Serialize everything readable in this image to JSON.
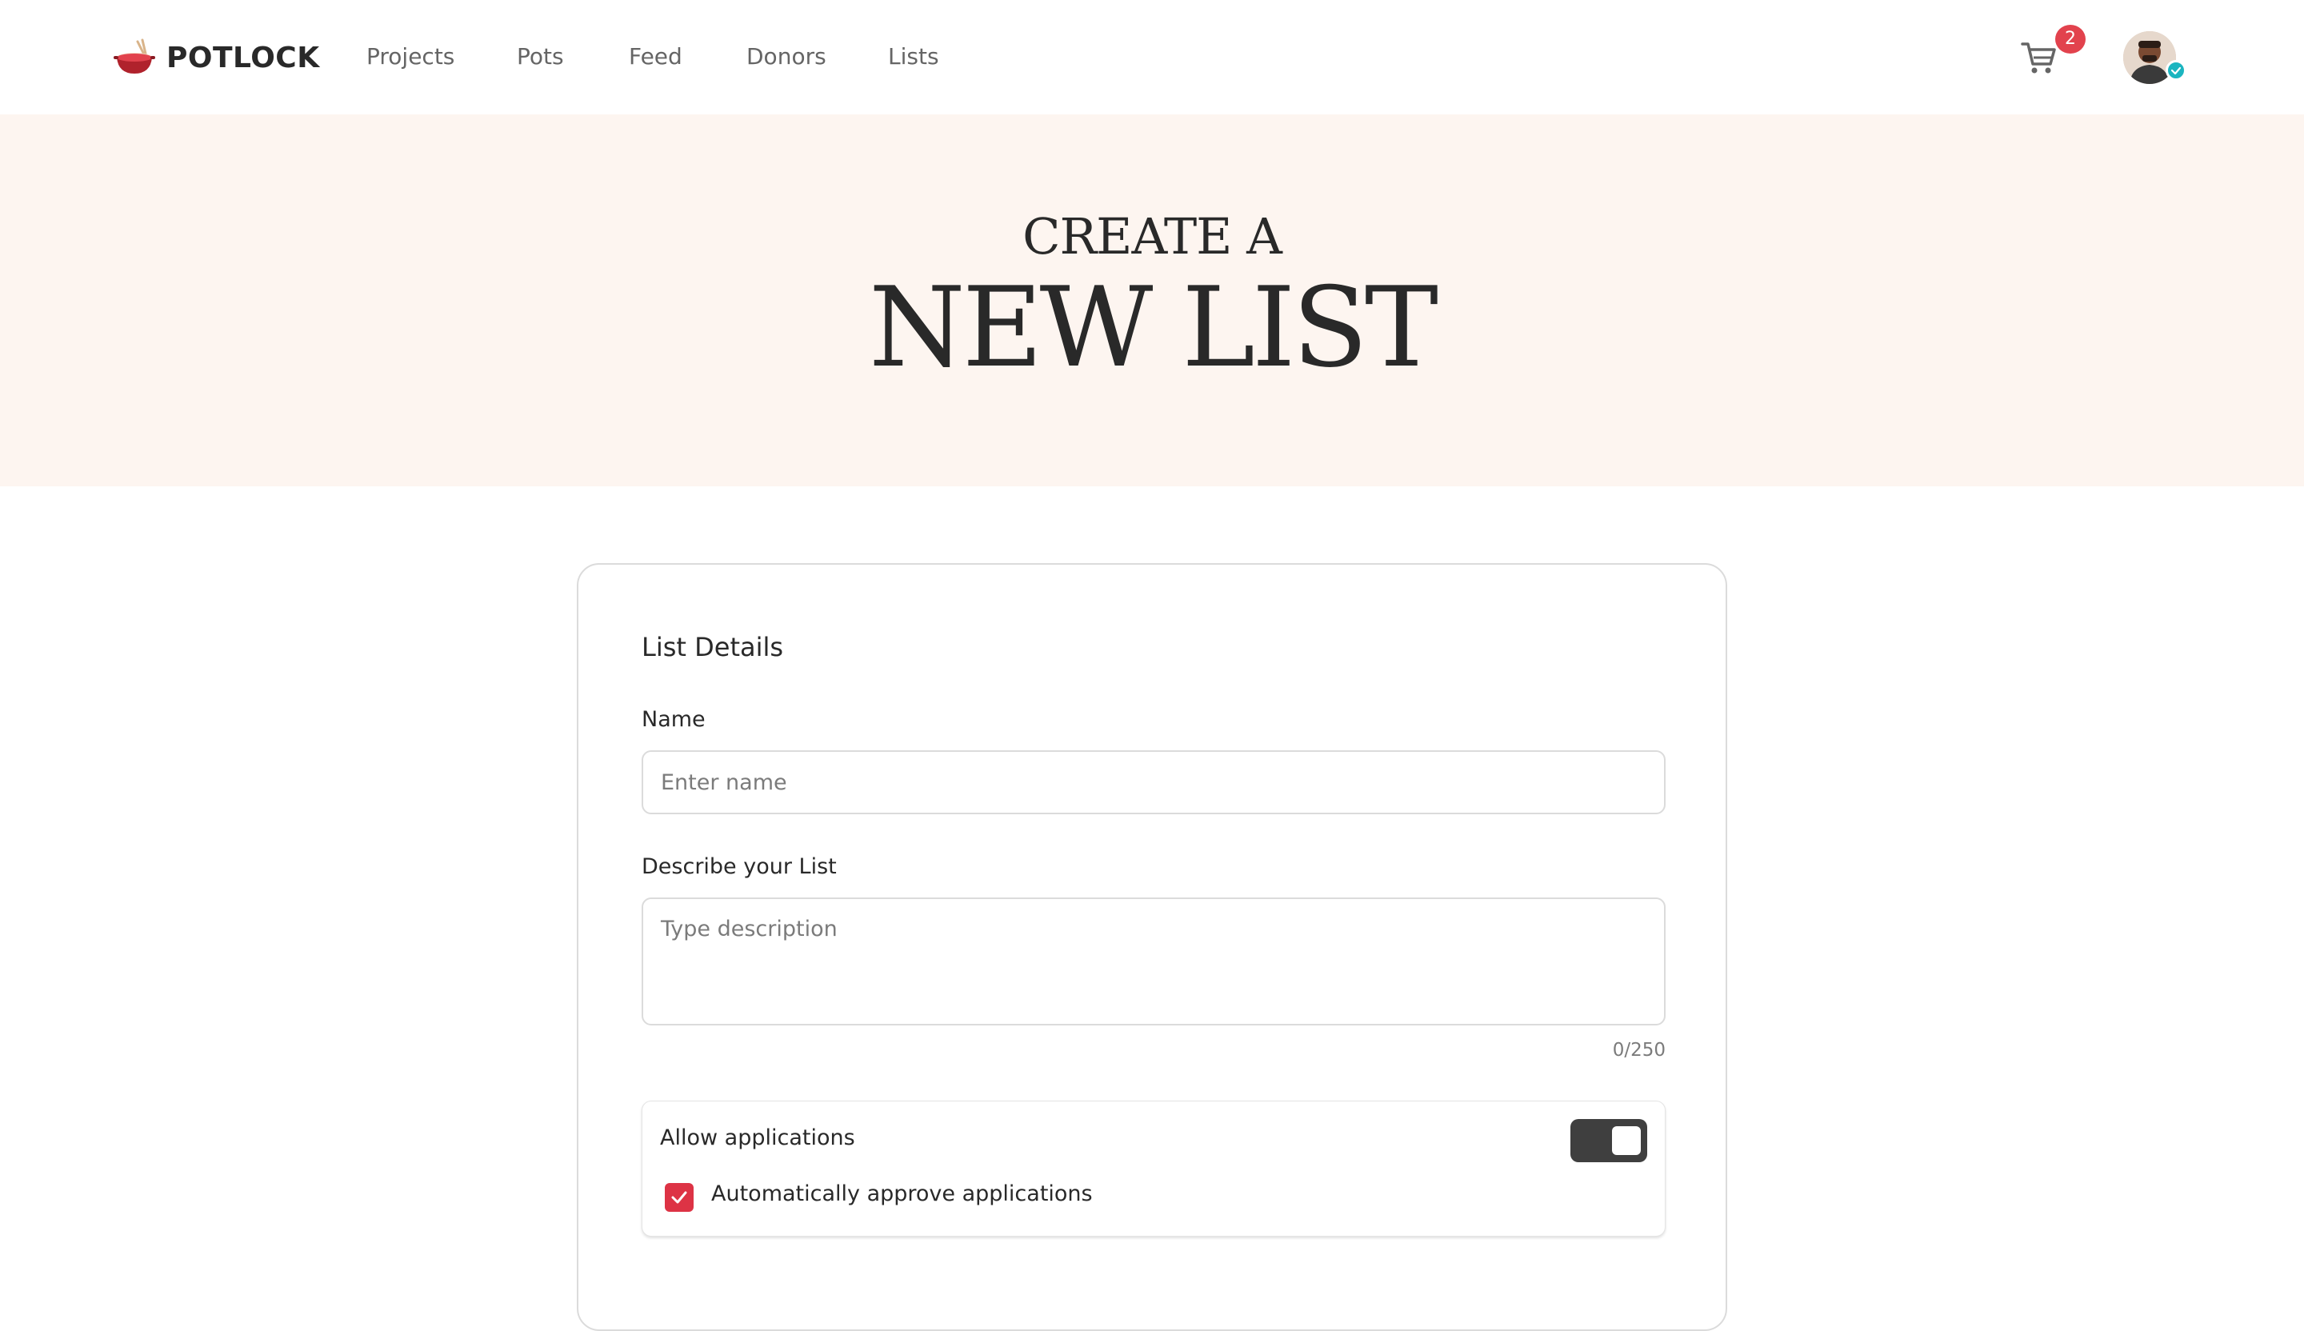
{
  "header": {
    "logo_text": "POTLOCK",
    "nav": [
      {
        "label": "Projects"
      },
      {
        "label": "Pots"
      },
      {
        "label": "Feed"
      },
      {
        "label": "Donors"
      },
      {
        "label": "Lists"
      }
    ],
    "cart_count": "2",
    "icons": {
      "cart": "shopping-cart-icon",
      "avatar": "user-avatar",
      "verified": "verified-badge-icon"
    }
  },
  "hero": {
    "subtitle": "CREATE A",
    "title": "NEW LIST"
  },
  "form": {
    "section_title": "List Details",
    "name": {
      "label": "Name",
      "placeholder": "Enter name",
      "value": ""
    },
    "description": {
      "label": "Describe your List",
      "placeholder": "Type description",
      "value": "",
      "counter": "0/250"
    },
    "applications": {
      "label": "Allow applications",
      "toggle_on": true,
      "auto_approve_label": "Automatically approve applications",
      "auto_approve_checked": true
    }
  },
  "colors": {
    "accent": "#dd3345",
    "hero_bg": "#fdf5f0",
    "text": "#292929",
    "muted": "#656565",
    "toggle_bg": "#3f3f3f",
    "verified": "#1bb5c0"
  }
}
